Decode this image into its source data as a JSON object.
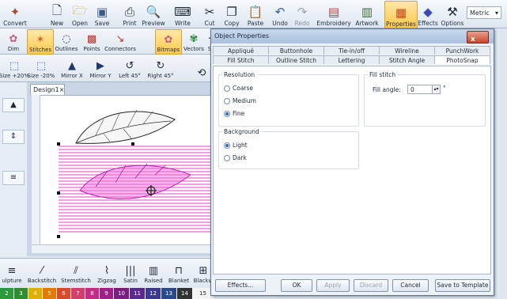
{
  "ribbon": {
    "buttons": [
      {
        "label": "Convert",
        "icon": "convert-icon"
      },
      {
        "label": "New",
        "icon": "new-doc-icon"
      },
      {
        "label": "Open",
        "icon": "folder-open-icon"
      },
      {
        "label": "Save",
        "icon": "save-icon"
      },
      {
        "label": "Print",
        "icon": "print-icon"
      },
      {
        "label": "Preview",
        "icon": "print-preview-icon"
      },
      {
        "label": "Write",
        "icon": "write-icon"
      },
      {
        "label": "Cut",
        "icon": "scissors-icon"
      },
      {
        "label": "Copy",
        "icon": "copy-icon"
      },
      {
        "label": "Paste",
        "icon": "paste-icon"
      },
      {
        "label": "Undo",
        "icon": "undo-icon"
      },
      {
        "label": "Redo",
        "icon": "redo-icon"
      },
      {
        "label": "Embroidery",
        "icon": "embroidery-icon"
      },
      {
        "label": "Artwork",
        "icon": "artwork-icon"
      },
      {
        "label": "Properties",
        "icon": "properties-icon"
      },
      {
        "label": "Effects",
        "icon": "effects-icon"
      },
      {
        "label": "Options",
        "icon": "options-icon"
      }
    ],
    "units_select": "Metric"
  },
  "toolbar2": {
    "buttons": [
      "Dim",
      "Stitches",
      "Outlines",
      "Points",
      "Connectors",
      "Bitmaps",
      "Vectors",
      "S"
    ]
  },
  "toolbar3": {
    "buttons": [
      "Size +20%",
      "Size -20%",
      "Mirror X",
      "Mirror Y",
      "Left 45°",
      "Right 45°"
    ]
  },
  "document": {
    "tab_label": "Design1",
    "close_symbol": "×"
  },
  "stitch_types": [
    "ulpture",
    "Backstitch",
    "Stemstitch",
    "Zigzag",
    "Satin",
    "Raised",
    "Blanket",
    "Blackw"
  ],
  "palette": [
    {
      "num": "2",
      "color": "#2a9a3a"
    },
    {
      "num": "3",
      "color": "#2f8f2f"
    },
    {
      "num": "4",
      "color": "#e0b000"
    },
    {
      "num": "5",
      "color": "#e07a00"
    },
    {
      "num": "6",
      "color": "#d84a2a"
    },
    {
      "num": "7",
      "color": "#d13f6a"
    },
    {
      "num": "8",
      "color": "#c42a86"
    },
    {
      "num": "9",
      "color": "#a0208a"
    },
    {
      "num": "10",
      "color": "#7a1e82"
    },
    {
      "num": "11",
      "color": "#5b2a8a"
    },
    {
      "num": "12",
      "color": "#3b3a8e"
    },
    {
      "num": "13",
      "color": "#2b4a8e"
    },
    {
      "num": "14",
      "color": "#333333"
    },
    {
      "num": "15",
      "color": "#f4f4f4"
    }
  ],
  "dialog": {
    "title": "Object Properties",
    "close_label": "x",
    "tabs_row1": [
      "Appliqué",
      "Buttonhole",
      "Tie-in/off",
      "Wireline",
      "PunchWork"
    ],
    "tabs_row2": [
      "Fill Stitch",
      "Outline Stitch",
      "Lettering",
      "Stitch Angle",
      "PhotoSnap"
    ],
    "active_tab": "PhotoSnap",
    "resolution": {
      "title": "Resolution",
      "options": [
        {
          "label": "Coarse",
          "selected": false
        },
        {
          "label": "Medium",
          "selected": false
        },
        {
          "label": "Fine",
          "selected": true
        }
      ]
    },
    "fill_stitch": {
      "title": "Fill stitch",
      "angle_label": "Fill angle:",
      "angle_value": "0",
      "unit": "°"
    },
    "background": {
      "title": "Background",
      "options": [
        {
          "label": "Light",
          "selected": true
        },
        {
          "label": "Dark",
          "selected": false
        }
      ]
    },
    "buttons": {
      "effects": "Effects...",
      "ok": "OK",
      "apply": "Apply",
      "discard": "Discard",
      "cancel": "Cancel",
      "save_template": "Save to Template"
    }
  }
}
